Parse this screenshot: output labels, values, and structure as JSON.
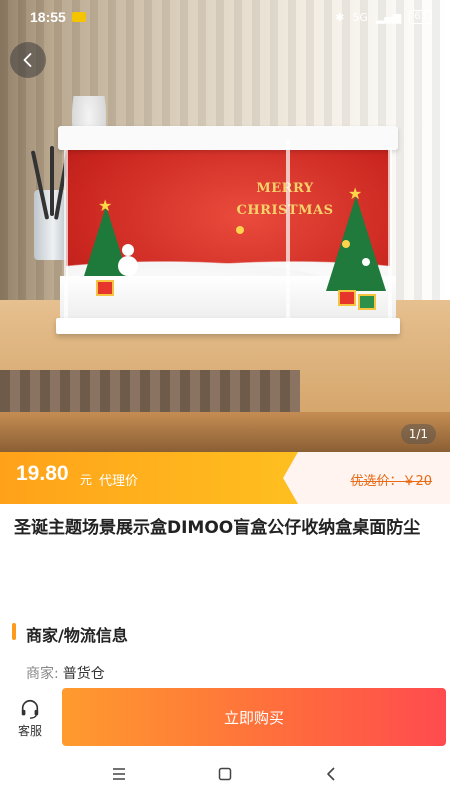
{
  "status_bar": {
    "time": "18:55",
    "network_label": "5G",
    "battery": "63"
  },
  "image": {
    "banner_text": "MERRY\nCHRISTMAS",
    "counter": "1/1"
  },
  "price": {
    "value": "19.80",
    "unit": "元",
    "label": "代理价",
    "original": "优选价：￥20",
    "colors": {
      "accent": "#ffa21a",
      "original": "#e86a17"
    }
  },
  "product": {
    "title": "圣诞主题场景展示盒DIMOO盲盒公仔收纳盒桌面防尘"
  },
  "merchant_section": {
    "title": "商家/物流信息",
    "merchant_key": "商家:",
    "merchant_value": "普货仓"
  },
  "actions": {
    "service_label": "客服",
    "buy_label": "立即购买",
    "buy_colors": [
      "#ff9b2e",
      "#ff4b4f"
    ]
  },
  "icons": {
    "back": "chevron-left-icon",
    "service": "headset-icon",
    "nav_menu": "menu-icon",
    "nav_home": "square-icon",
    "nav_back": "triangle-back-icon"
  }
}
